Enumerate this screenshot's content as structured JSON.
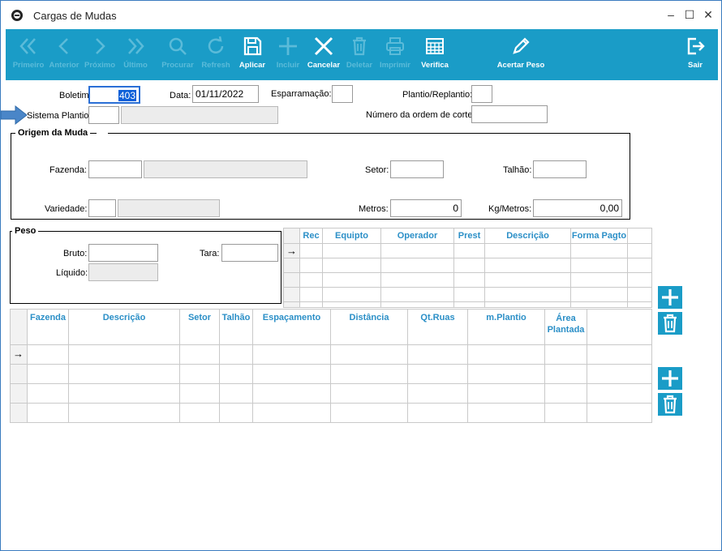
{
  "window": {
    "title": "Cargas de Mudas"
  },
  "toolbar": {
    "primeiro": "Primeiro",
    "anterior": "Anterior",
    "proximo": "Próximo",
    "ultimo": "Último",
    "procurar": "Procurar",
    "refresh": "Refresh",
    "aplicar": "Aplicar",
    "incluir": "Incluir",
    "cancelar": "Cancelar",
    "deletar": "Deletar",
    "imprimir": "Imprimir",
    "verifica": "Verifica",
    "acertar_peso": "Acertar Peso",
    "sair": "Sair"
  },
  "form": {
    "boletim_label": "Boletim",
    "boletim_value": "403",
    "data_label": "Data:",
    "data_value": "01/11/2022",
    "esparramacao_label": "Esparramação:",
    "esparramacao_value": "",
    "plantio_label": "Plantio/Replantio:",
    "plantio_value": "",
    "sistema_label": "Sistema Plantio:",
    "sistema_value": "",
    "ordem_corte_label": "Número da ordem de corte:",
    "ordem_corte_value": ""
  },
  "origem": {
    "title": "Origem da Muda",
    "fazenda_label": "Fazenda:",
    "setor_label": "Setor:",
    "talhao_label": "Talhão:",
    "variedade_label": "Variedade:",
    "metros_label": "Metros:",
    "metros_value": "0",
    "kg_metros_label": "Kg/Metros:",
    "kg_metros_value": "0,00"
  },
  "peso": {
    "title": "Peso",
    "bruto_label": "Bruto:",
    "tara_label": "Tara:",
    "liquido_label": "Líquido:"
  },
  "grid1": {
    "columns": [
      "Rec",
      "Equipto",
      "Operador",
      "Prest",
      "Descrição",
      "Forma Pagto"
    ]
  },
  "grid2": {
    "columns": [
      "Fazenda",
      "Descrição",
      "Setor",
      "Talhão",
      "Espaçamento",
      "Distância",
      "Qt.Ruas",
      "m.Plantio",
      "Área Plantada"
    ]
  },
  "colors": {
    "toolbar": "#1a9cc7",
    "header_text": "#2b8fc7",
    "disabled_label": "#5bbbd9"
  }
}
